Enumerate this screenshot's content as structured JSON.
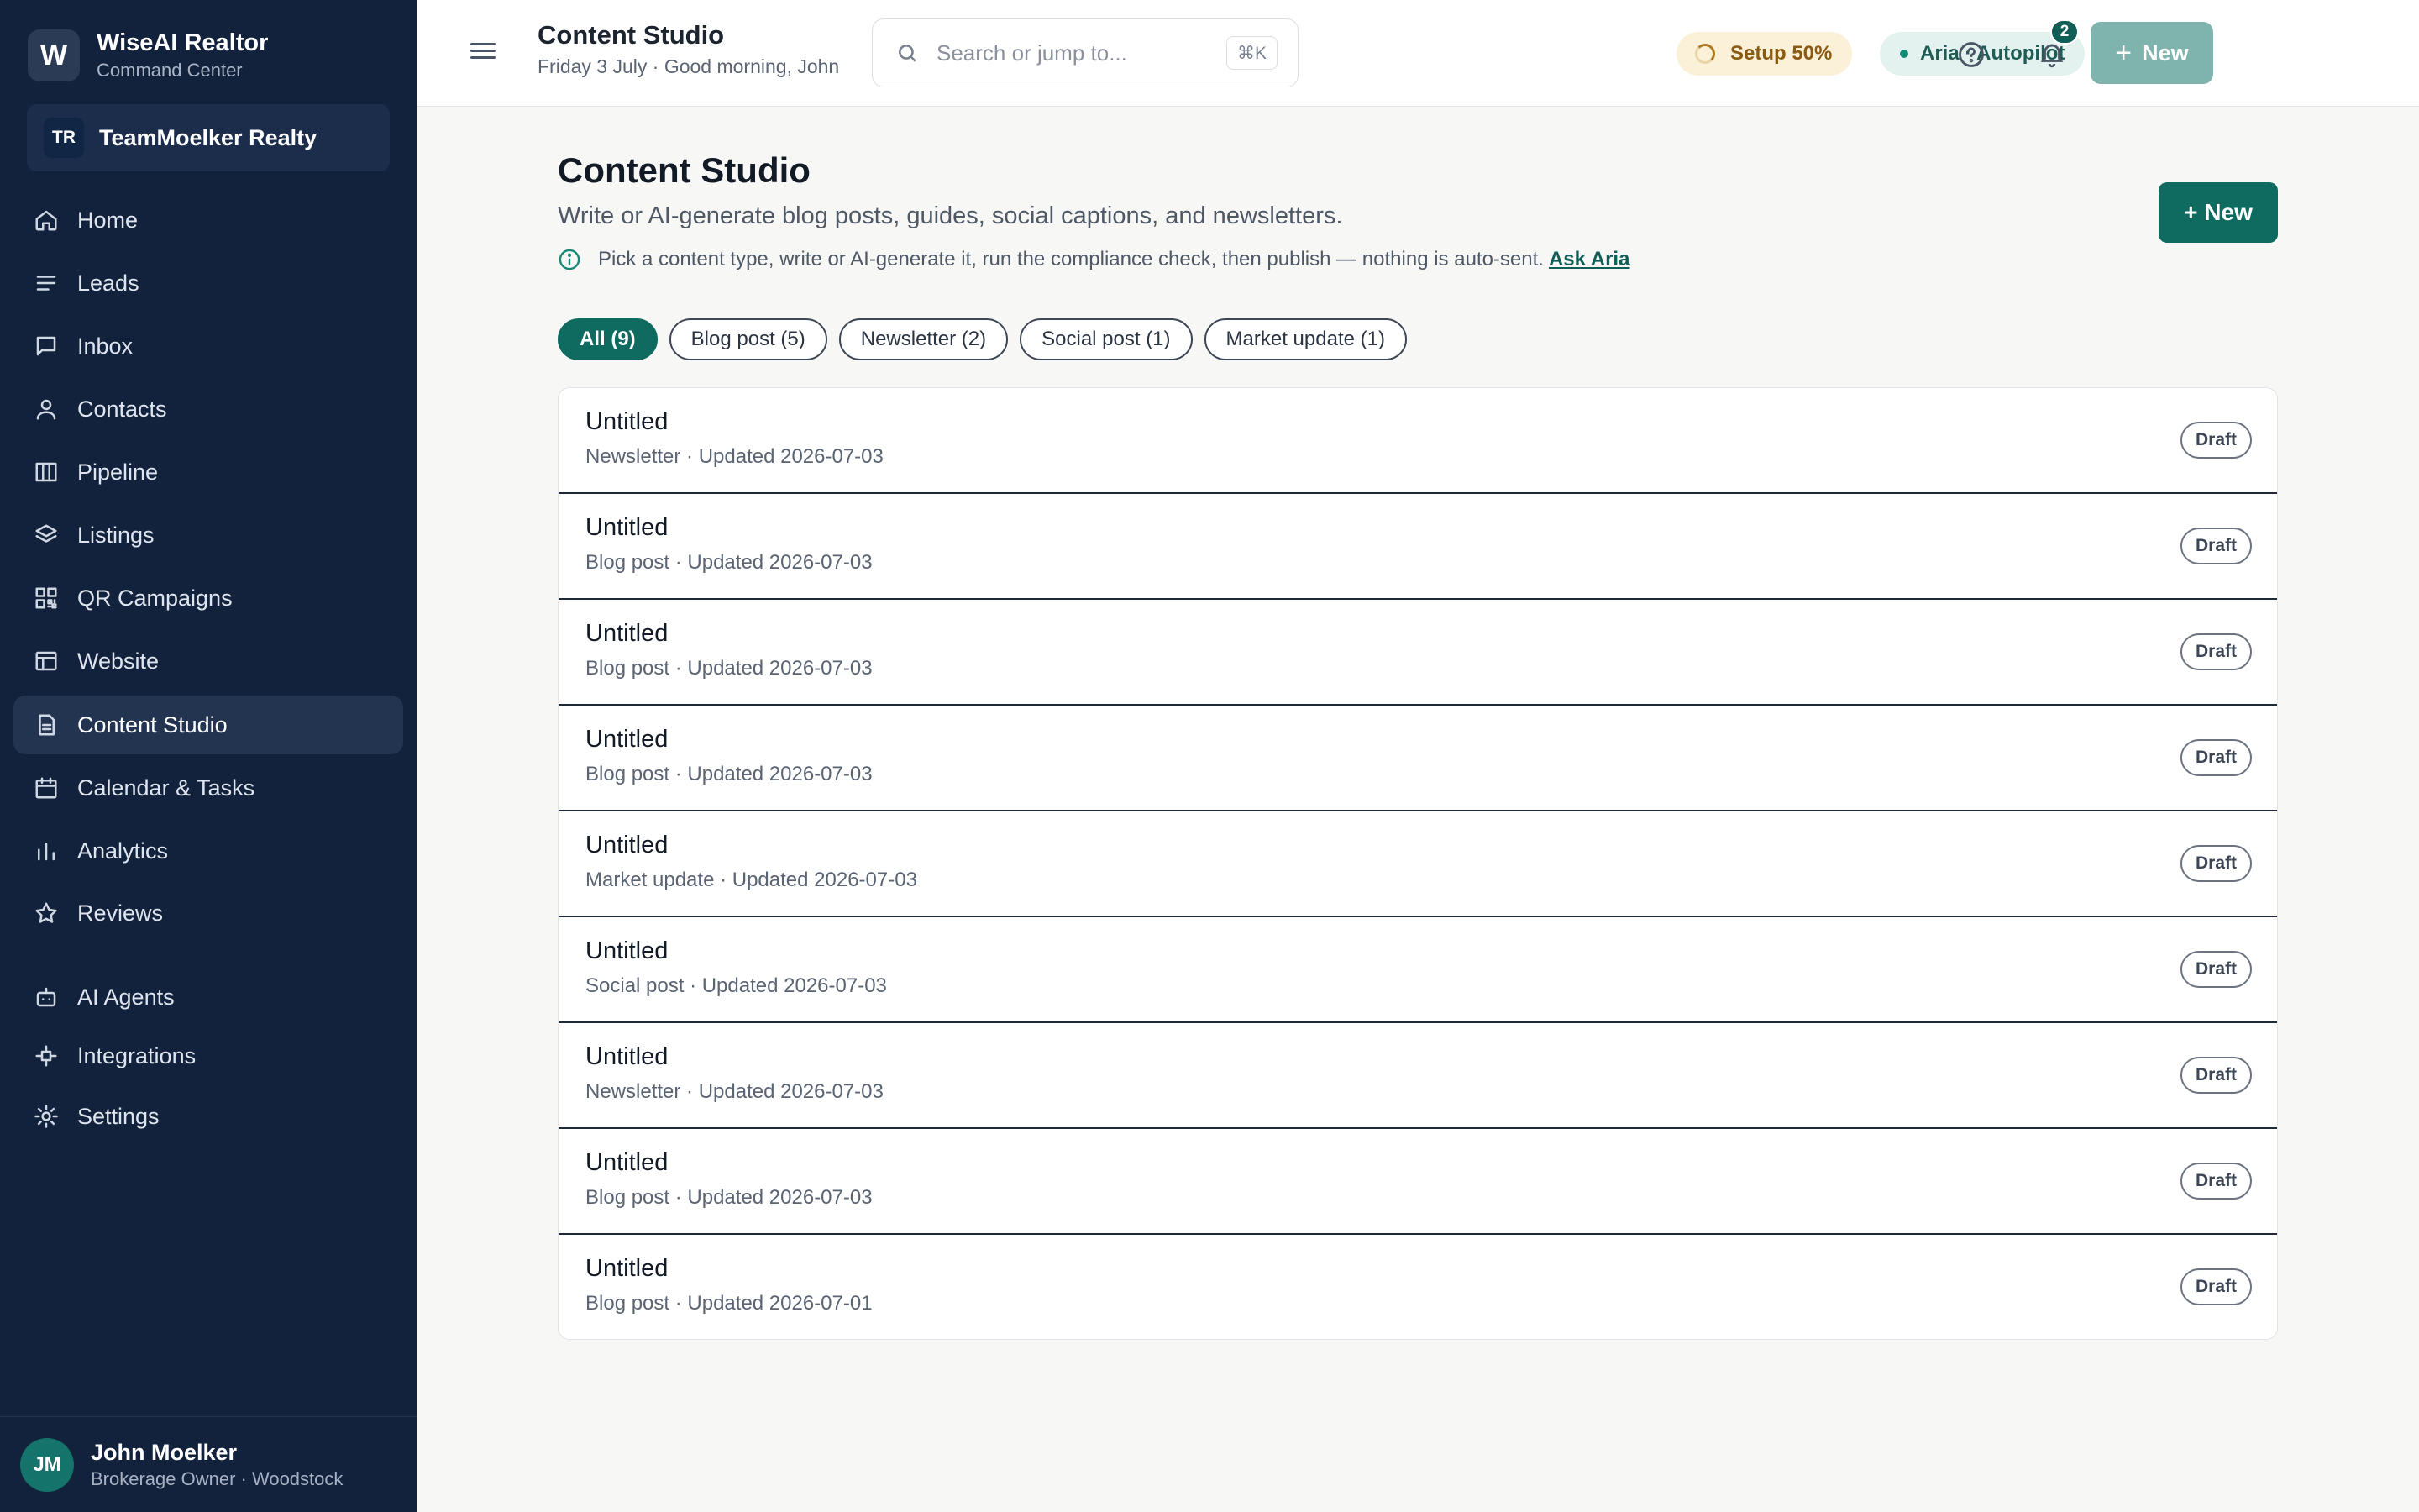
{
  "brand": {
    "logo": "W",
    "name": "WiseAI Realtor",
    "sub": "Command Center"
  },
  "team": {
    "initials": "TR",
    "name": "TeamMoelker Realty"
  },
  "nav": [
    {
      "label": "Home",
      "icon": "home-icon"
    },
    {
      "label": "Leads",
      "icon": "lines-icon"
    },
    {
      "label": "Inbox",
      "icon": "message-icon"
    },
    {
      "label": "Contacts",
      "icon": "user-icon"
    },
    {
      "label": "Pipeline",
      "icon": "columns-icon"
    },
    {
      "label": "Listings",
      "icon": "layers-icon"
    },
    {
      "label": "QR Campaigns",
      "icon": "qr-icon"
    },
    {
      "label": "Website",
      "icon": "layout-icon"
    },
    {
      "label": "Content Studio",
      "icon": "document-icon",
      "active": true
    },
    {
      "label": "Calendar & Tasks",
      "icon": "calendar-icon"
    },
    {
      "label": "Analytics",
      "icon": "bar-chart-icon"
    },
    {
      "label": "Reviews",
      "icon": "star-icon"
    },
    {
      "label": "AI Agents",
      "icon": "robot-icon"
    },
    {
      "label": "Integrations",
      "icon": "plug-icon"
    },
    {
      "label": "Settings",
      "icon": "gear-icon"
    }
  ],
  "user": {
    "initials": "JM",
    "name": "John Moelker",
    "role": "Brokerage Owner · Woodstock"
  },
  "topbar": {
    "title": "Content Studio",
    "subtitle": "Friday 3 July · Good morning, John",
    "search_placeholder": "Search or jump to...",
    "shortcut": "⌘K",
    "setup": "Setup 50%",
    "setup_progress": 0.5,
    "aria": "Aria · Autopilot",
    "notifications": "2",
    "new_label": "New"
  },
  "page": {
    "title": "Content Studio",
    "subtitle": "Write or AI-generate blog posts, guides, social captions, and newsletters.",
    "info": "Pick a content type, write or AI-generate it, run the compliance check, then publish — nothing is auto-sent.",
    "ask": "Ask Aria",
    "new_label": "+ New"
  },
  "filters": [
    {
      "label": "All (9)",
      "active": true
    },
    {
      "label": "Blog post (5)"
    },
    {
      "label": "Newsletter (2)"
    },
    {
      "label": "Social post (1)"
    },
    {
      "label": "Market update (1)"
    }
  ],
  "items": [
    {
      "title": "Untitled",
      "meta": "Newsletter · Updated 2026-07-03",
      "status": "Draft"
    },
    {
      "title": "Untitled",
      "meta": "Blog post · Updated 2026-07-03",
      "status": "Draft"
    },
    {
      "title": "Untitled",
      "meta": "Blog post · Updated 2026-07-03",
      "status": "Draft"
    },
    {
      "title": "Untitled",
      "meta": "Blog post · Updated 2026-07-03",
      "status": "Draft"
    },
    {
      "title": "Untitled",
      "meta": "Market update · Updated 2026-07-03",
      "status": "Draft"
    },
    {
      "title": "Untitled",
      "meta": "Social post · Updated 2026-07-03",
      "status": "Draft"
    },
    {
      "title": "Untitled",
      "meta": "Newsletter · Updated 2026-07-03",
      "status": "Draft"
    },
    {
      "title": "Untitled",
      "meta": "Blog post · Updated 2026-07-03",
      "status": "Draft"
    },
    {
      "title": "Untitled",
      "meta": "Blog post · Updated 2026-07-01",
      "status": "Draft"
    }
  ]
}
